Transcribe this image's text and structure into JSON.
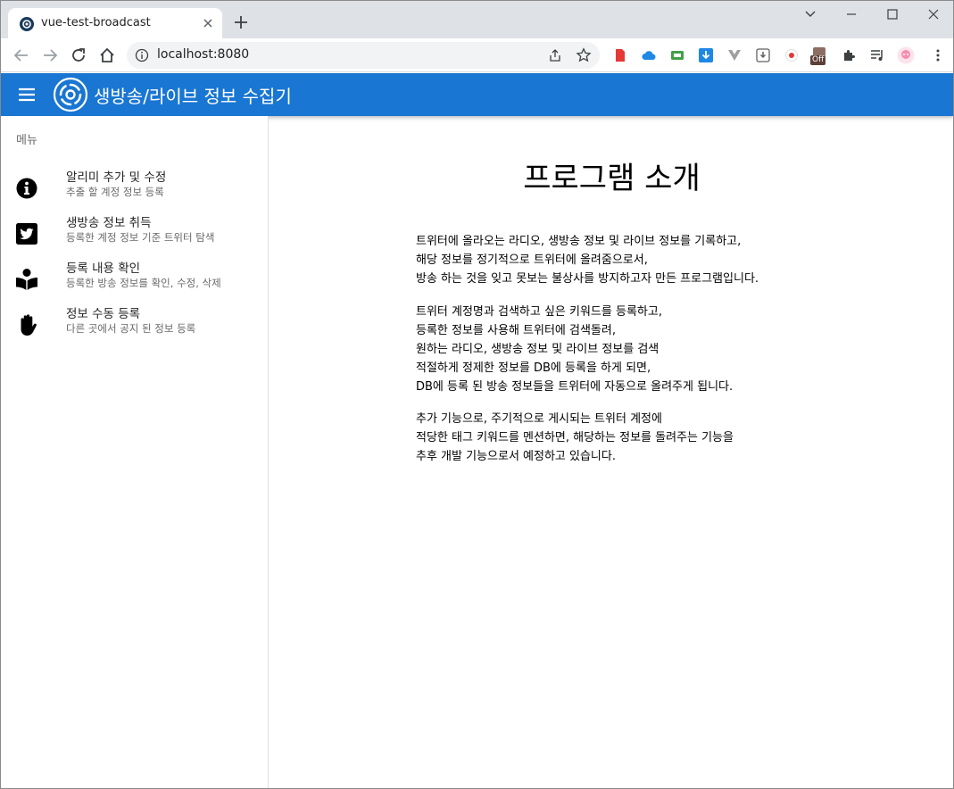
{
  "browser": {
    "tab_title": "vue-test-broadcast",
    "url": "localhost:8080",
    "extension_badge": "Off"
  },
  "app": {
    "title": "생방송/라이브 정보 수집기",
    "brand_color": "#1976d2"
  },
  "drawer": {
    "subheader": "메뉴",
    "items": [
      {
        "title": "알리미 추가 및 수정",
        "subtitle": "추출 할 계정 정보 등록",
        "icon": "info-circle-icon"
      },
      {
        "title": "생방송 정보 취득",
        "subtitle": "등록한 계정 정보 기준 트위터 탐색",
        "icon": "twitter-icon"
      },
      {
        "title": "등록 내용 확인",
        "subtitle": "등록한 방송 정보를 확인, 수정, 삭제",
        "icon": "book-reader-icon"
      },
      {
        "title": "정보 수동 등록",
        "subtitle": "다른 곳에서 공지 된 정보 등록",
        "icon": "hand-icon"
      }
    ]
  },
  "main": {
    "heading": "프로그램 소개",
    "paragraphs": [
      [
        "트위터에 올라오는 라디오, 생방송 정보 및 라이브 정보를 기록하고,",
        "해당 정보를 정기적으로 트위터에 올려줌으로서,",
        "방송 하는 것을 잊고 못보는 불상사를 방지하고자 만든 프로그램입니다."
      ],
      [
        "트위터 계정명과 검색하고 싶은 키워드를 등록하고,",
        "등록한 정보를 사용해 트위터에 검색돌려,",
        "원하는 라디오, 생방송 정보 및 라이브 정보를 검색",
        "적절하게 정제한 정보를 DB에 등록을 하게 되면,",
        "DB에 등록 된 방송 정보들을 트위터에 자동으로 올려주게 됩니다."
      ],
      [
        "추가 기능으로, 주기적으로 게시되는 트위터 계정에",
        "적당한 태그 키워드를 멘션하면, 해당하는 정보를 돌려주는 기능을",
        "추후 개발 기능으로서 예정하고 있습니다."
      ]
    ]
  }
}
